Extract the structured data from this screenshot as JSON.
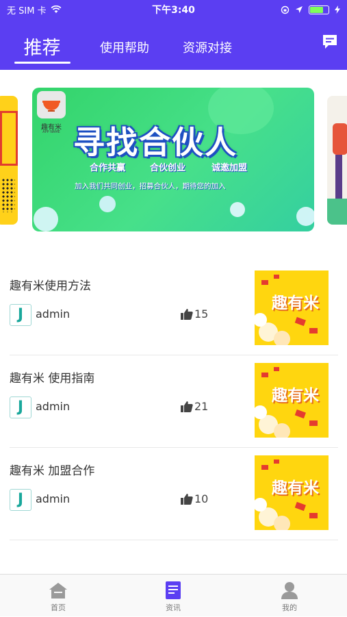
{
  "status_bar": {
    "carrier": "无 SIM 卡",
    "time": "下午3:40",
    "battery_level": 0.72
  },
  "header": {
    "tabs": [
      {
        "label": "推荐",
        "active": true
      },
      {
        "label": "使用帮助",
        "active": false
      },
      {
        "label": "资源对接",
        "active": false
      }
    ],
    "message_icon": "message-icon"
  },
  "carousel": {
    "logo_name": "趣有米",
    "logo_sub": "APP NAME",
    "title": "寻找合伙人",
    "tags": [
      "合作共赢",
      "合伙创业",
      "诚邀加盟"
    ],
    "description": "加入我们共同创业，招募合伙人，期待您的加入",
    "active_index": 1,
    "page_count": 3
  },
  "articles": [
    {
      "title": "趣有米使用方法",
      "author": "admin",
      "likes": "15",
      "thumb_text": "趣有米"
    },
    {
      "title": "趣有米 使用指南",
      "author": "admin",
      "likes": "21",
      "thumb_text": "趣有米"
    },
    {
      "title": "趣有米 加盟合作",
      "author": "admin",
      "likes": "10",
      "thumb_text": "趣有米"
    }
  ],
  "tabbar": {
    "items": [
      {
        "label": "首页",
        "icon": "home-icon",
        "active": false
      },
      {
        "label": "资讯",
        "icon": "news-icon",
        "active": true
      },
      {
        "label": "我的",
        "icon": "profile-icon",
        "active": false
      }
    ]
  },
  "colors": {
    "primary": "#5b3ef2",
    "banner_green": "#3ddc78",
    "thumb_yellow": "#ffd60f"
  }
}
